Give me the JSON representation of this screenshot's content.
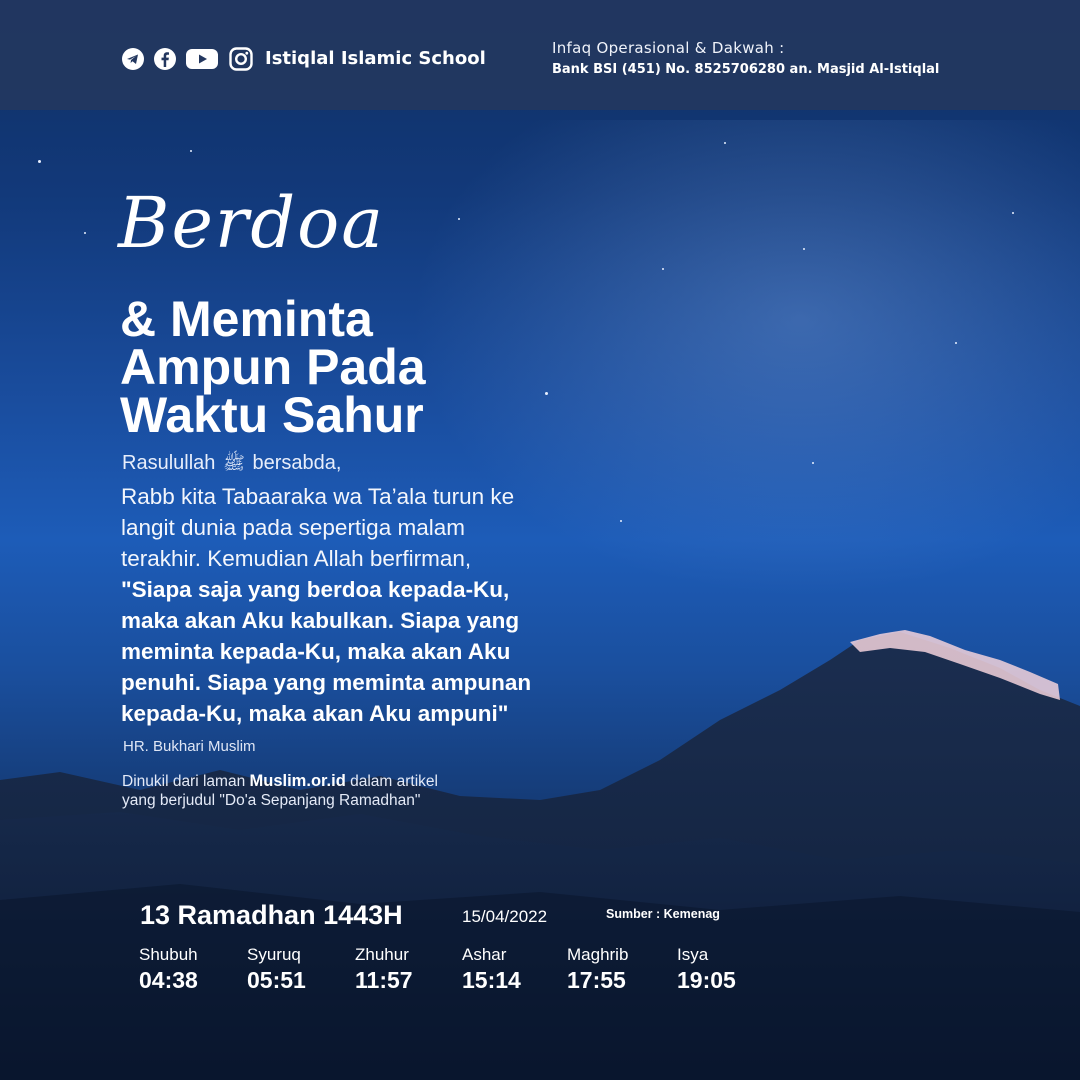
{
  "header": {
    "school_name": "Istiqlal Islamic School",
    "infaq_label": "Infaq Operasional & Dakwah :",
    "bank_info": "Bank BSI (451) No. 8525706280 an. Masjid Al-Istiqlal",
    "social_icons": [
      "telegram-icon",
      "facebook-icon",
      "youtube-icon",
      "instagram-icon"
    ]
  },
  "headline": {
    "script_word": "Berdoa",
    "line1": "& Meminta",
    "line2": "Ampun Pada",
    "line3": "Waktu Sahur"
  },
  "content": {
    "intro_before": "Rasulullah",
    "intro_after": "bersabda,",
    "regular_lines": [
      "Rabb kita Tabaaraka wa Ta’ala turun ke",
      "langit dunia pada sepertiga malam",
      "terakhir. Kemudian Allah berfirman,"
    ],
    "bold_lines": [
      "\"Siapa saja yang berdoa kepada-Ku,",
      "maka akan Aku kabulkan. Siapa yang",
      "meminta kepada-Ku, maka akan Aku",
      "penuhi. Siapa yang meminta ampunan",
      "kepada-Ku, maka akan Aku ampuni\""
    ],
    "reference": "HR. Bukhari Muslim",
    "source_prefix": "Dinukil dari laman",
    "source_site": "Muslim.or.id",
    "source_suffix": "dalam artikel",
    "source_line2": "yang berjudul \"Do'a Sepanjang Ramadhan\""
  },
  "schedule": {
    "hijri_date": "13 Ramadhan 1443H",
    "gregorian_date": "15/04/2022",
    "source": "Sumber : Kemenag",
    "prayers": [
      {
        "name": "Shubuh",
        "time": "04:38"
      },
      {
        "name": "Syuruq",
        "time": "05:51"
      },
      {
        "name": "Zhuhur",
        "time": "11:57"
      },
      {
        "name": "Ashar",
        "time": "15:14"
      },
      {
        "name": "Maghrib",
        "time": "17:55"
      },
      {
        "name": "Isya",
        "time": "19:05"
      }
    ]
  },
  "colors": {
    "sky_top": "#0f2f63",
    "sky_mid": "#1d5cb8",
    "header_bar": "#23375f",
    "text": "#ffffff"
  }
}
